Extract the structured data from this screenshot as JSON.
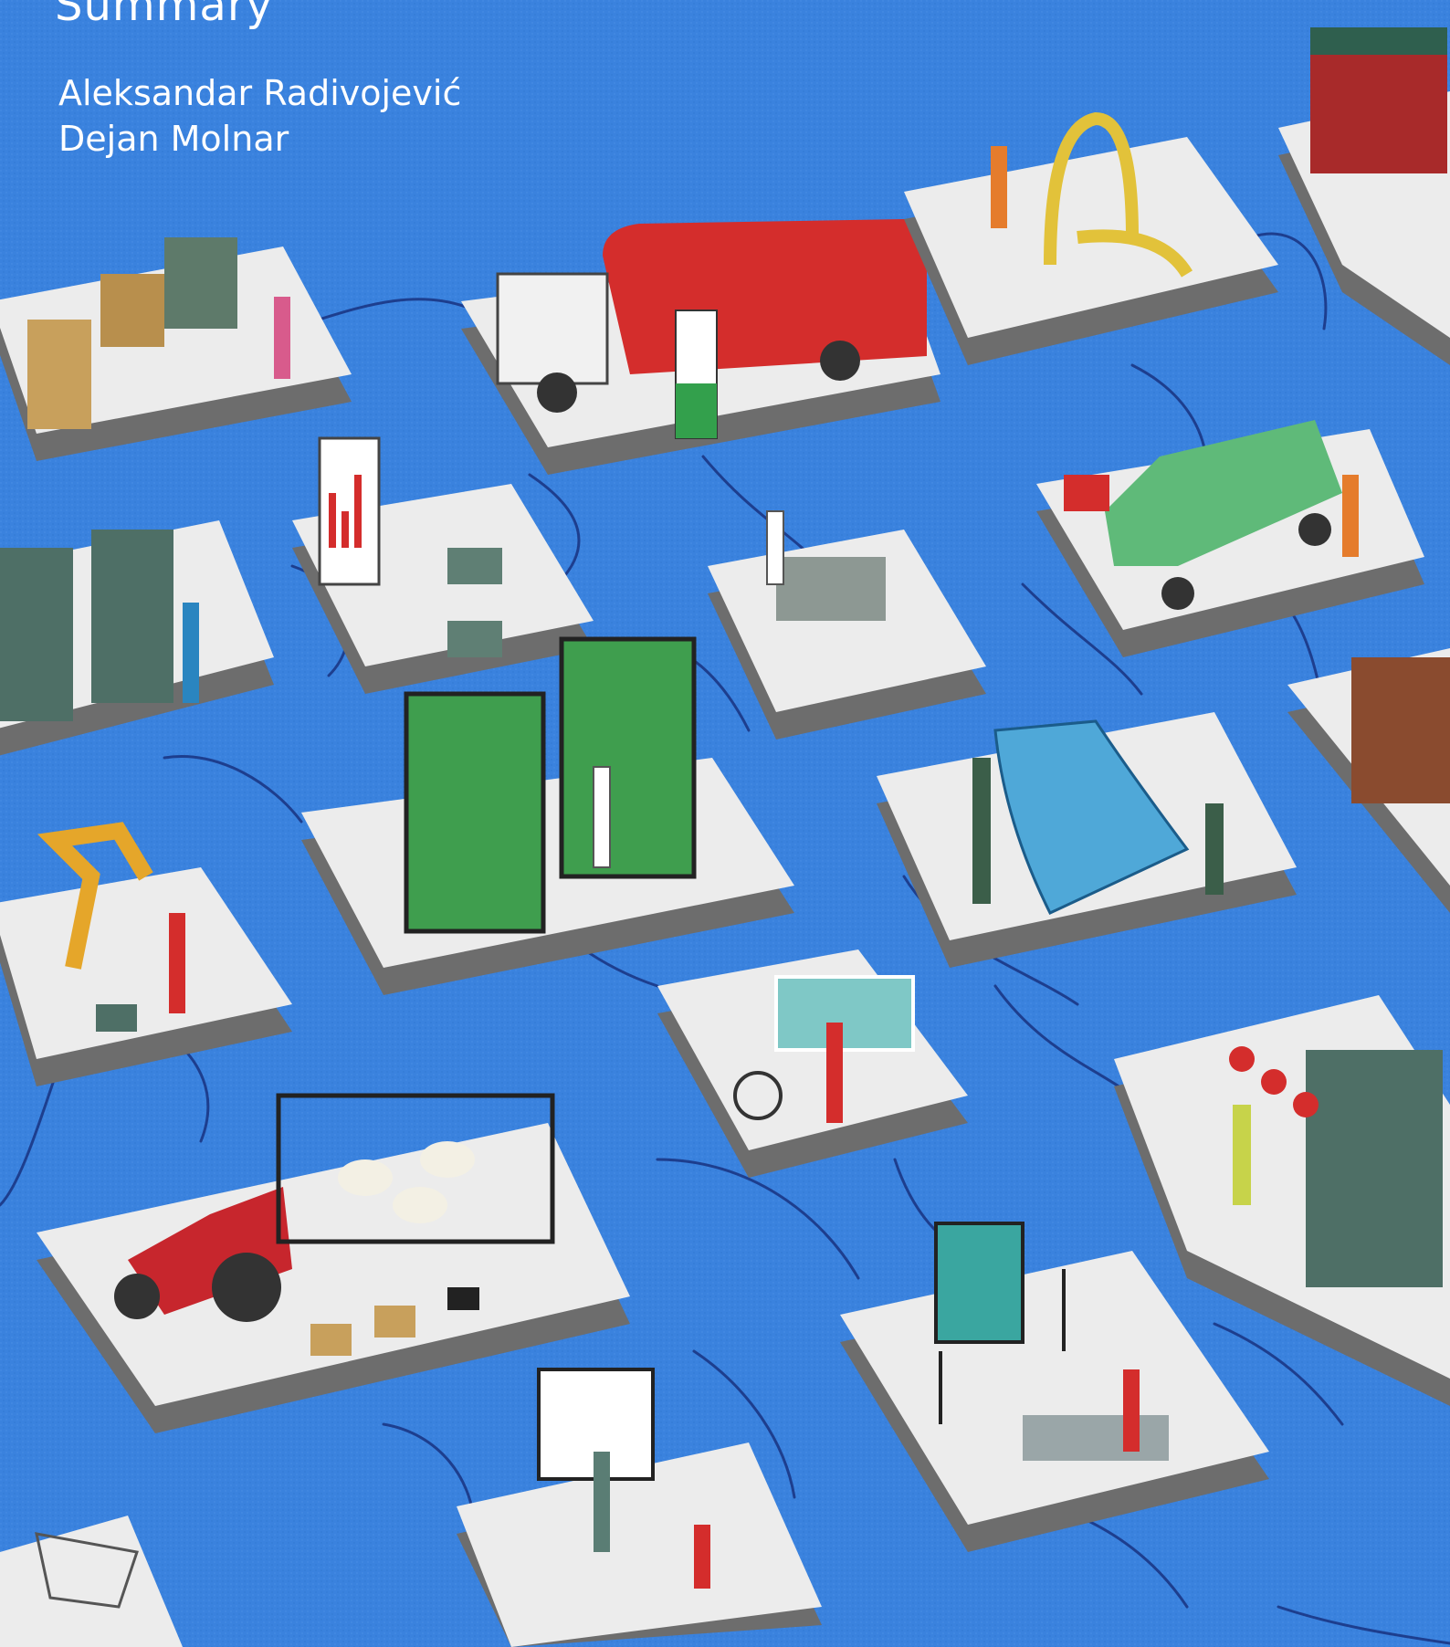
{
  "cover": {
    "title": "Summary",
    "authors": [
      "Aleksandar Radivojević",
      "Dejan Molnar"
    ]
  },
  "colors": {
    "background": "#3a82de",
    "connector": "#1d3e8e",
    "platform_top": "#ececec",
    "platform_side": "#6d6d6d",
    "tanker_red": "#d42d2c",
    "van_green": "#5fba79",
    "machine_green": "#4e6f66",
    "fuel_pump_green": "#33a04c",
    "robot_arm_yellow": "#e5a62a",
    "tractor_red": "#c7262d",
    "coffee_stall_red": "#a82a2a"
  },
  "illustration": {
    "platforms": [
      {
        "scene": "warehouse-forklift",
        "icons": [
          "forklift-icon",
          "crate-icon",
          "worker-icon"
        ]
      },
      {
        "scene": "fuel-tanker",
        "icons": [
          "tanker-truck-icon",
          "fuel-pump-icon",
          "worker-icon"
        ]
      },
      {
        "scene": "pipe-construction",
        "icons": [
          "pipe-icon",
          "worker-icon"
        ]
      },
      {
        "scene": "coffee-stall",
        "icons": [
          "stall-icon",
          "customer-icon"
        ]
      },
      {
        "scene": "server-room",
        "icons": [
          "server-rack-icon",
          "technician-icon"
        ]
      },
      {
        "scene": "office-analytics",
        "icons": [
          "whiteboard-chart-icon",
          "desk-computer-icon"
        ]
      },
      {
        "scene": "laboratory",
        "icons": [
          "lab-bench-icon",
          "scientist-icon"
        ]
      },
      {
        "scene": "delivery",
        "icons": [
          "scooter-icon",
          "delivery-van-icon",
          "courier-icon"
        ]
      },
      {
        "scene": "vertical-farm",
        "icons": [
          "plant-shelf-icon",
          "gardener-icon"
        ]
      },
      {
        "scene": "solar-panel",
        "icons": [
          "solar-panel-icon",
          "ladder-icon",
          "worker-icon"
        ]
      },
      {
        "scene": "courtroom",
        "icons": [
          "judge-bench-icon",
          "judge-icon"
        ]
      },
      {
        "scene": "robot-arm",
        "icons": [
          "robot-arm-icon",
          "toolbox-icon",
          "engineer-icon"
        ]
      },
      {
        "scene": "hospital",
        "icons": [
          "hospital-bed-icon",
          "wheelchair-icon",
          "nurse-icon"
        ]
      },
      {
        "scene": "factory-line",
        "icons": [
          "factory-machine-icon",
          "worker-icon"
        ]
      },
      {
        "scene": "farm",
        "icons": [
          "tractor-icon",
          "sheep-icon",
          "dog-icon",
          "hay-bale-icon"
        ]
      },
      {
        "scene": "photo-studio",
        "icons": [
          "camera-tripod-icon",
          "light-stand-icon"
        ]
      },
      {
        "scene": "design-office",
        "icons": [
          "computer-icon",
          "designer-icon"
        ]
      },
      {
        "scene": "classroom",
        "icons": [
          "whiteboard-icon",
          "teacher-icon",
          "student-icon"
        ]
      },
      {
        "scene": "shopping",
        "icons": [
          "shopping-cart-icon"
        ]
      }
    ]
  }
}
